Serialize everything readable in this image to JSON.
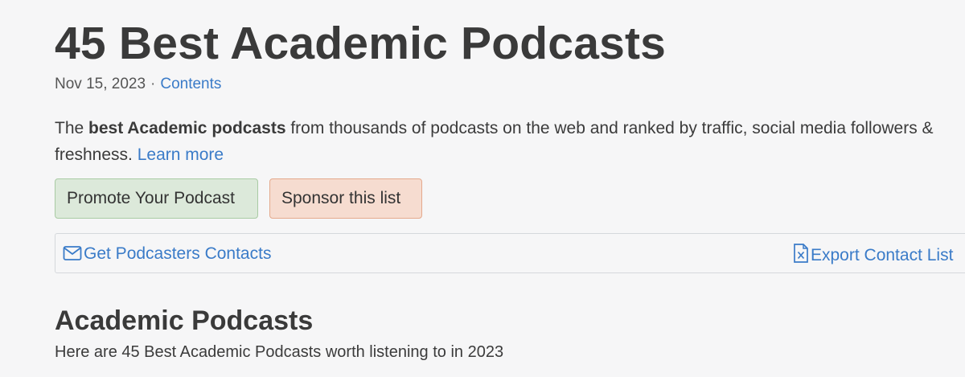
{
  "header": {
    "title": "45 Best Academic Podcasts",
    "date": "Nov 15, 2023",
    "separator": "·",
    "contents_link": "Contents"
  },
  "intro": {
    "prefix": "The ",
    "bold": "best Academic podcasts",
    "suffix": " from thousands of podcasts on the web and ranked by traffic, social media followers & freshness. ",
    "learn_more": "Learn more"
  },
  "buttons": {
    "promote": "Promote Your Podcast",
    "sponsor": "Sponsor this list"
  },
  "contact_bar": {
    "get_contacts": "Get Podcasters Contacts",
    "get_contacts_icon": "envelope-icon",
    "export": "Export Contact List",
    "export_icon": "excel-file-icon"
  },
  "section": {
    "title": "Academic Podcasts",
    "subtitle": "Here are 45 Best Academic Podcasts worth listening to in 2023"
  },
  "colors": {
    "link": "#3a7bc8",
    "promote_bg": "#dce9da",
    "sponsor_bg": "#f6dcd0"
  }
}
